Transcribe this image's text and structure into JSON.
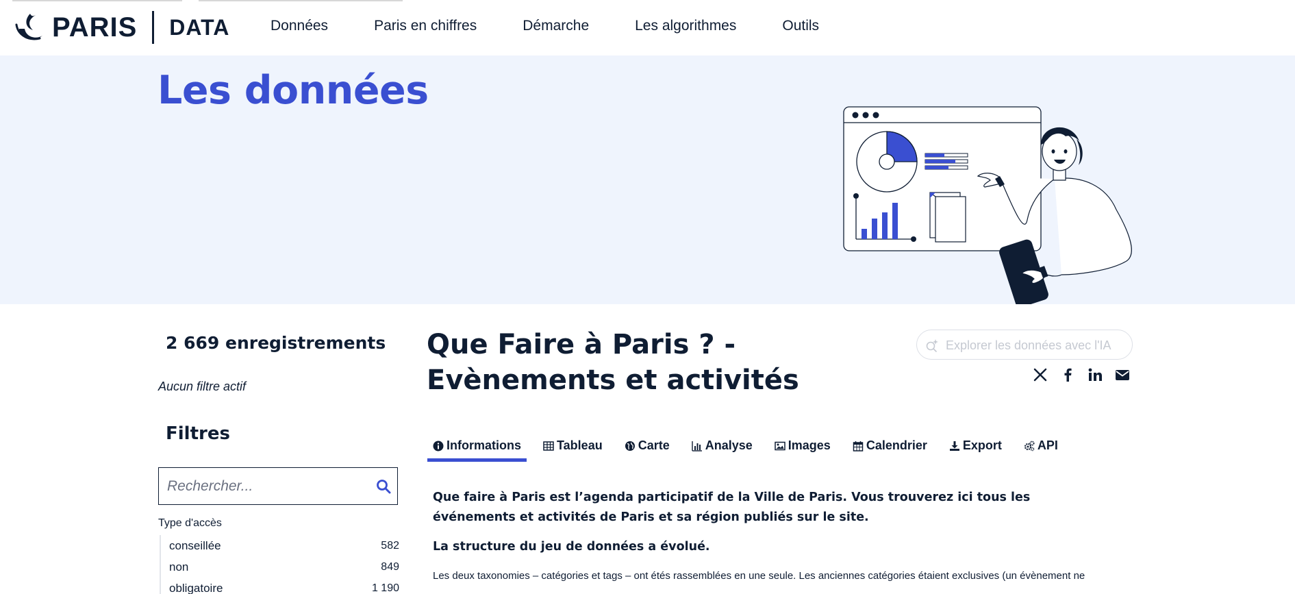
{
  "brand": {
    "city": "PARIS",
    "section": "DATA"
  },
  "nav": [
    {
      "label": "Données"
    },
    {
      "label": "Paris en chiffres"
    },
    {
      "label": "Démarche"
    },
    {
      "label": "Les algorithmes"
    },
    {
      "label": "Outils"
    }
  ],
  "hero": {
    "title": "Les données"
  },
  "sidebar": {
    "records": "2 669 enregistrements",
    "no_filter": "Aucun filtre actif",
    "filters_title": "Filtres",
    "search_placeholder": "Rechercher...",
    "facet": {
      "title": "Type d'accès",
      "items": [
        {
          "label": "conseillée",
          "count": "582"
        },
        {
          "label": "non",
          "count": "849"
        },
        {
          "label": "obligatoire",
          "count": "1 190"
        }
      ]
    }
  },
  "dataset": {
    "title": "Que Faire à Paris ? - Evènements et activités",
    "ai_placeholder": "Explorer les données avec l'IA",
    "share": [
      "x-icon",
      "facebook-icon",
      "linkedin-icon",
      "email-icon"
    ],
    "tabs": [
      {
        "label": "Informations",
        "icon": "info-icon",
        "active": true
      },
      {
        "label": "Tableau",
        "icon": "table-icon"
      },
      {
        "label": "Carte",
        "icon": "globe-icon"
      },
      {
        "label": "Analyse",
        "icon": "bar-chart-icon"
      },
      {
        "label": "Images",
        "icon": "image-icon"
      },
      {
        "label": "Calendrier",
        "icon": "calendar-icon"
      },
      {
        "label": "Export",
        "icon": "download-icon"
      },
      {
        "label": "API",
        "icon": "gears-icon"
      }
    ],
    "description": {
      "lead": "Que faire à Paris est l’agenda participatif de la Ville de Paris. Vous trouverez ici tous les événements et activités de Paris et sa région publiés sur le site.",
      "sub": "La structure du jeu de données a évolué.",
      "body": "Les deux taxonomies – catégories et tags – ont étés rassemblées en une seule. Les anciennes catégories étaient exclusives (un évènement ne"
    }
  },
  "colors": {
    "accent": "#3a4fd1",
    "hero_bg": "#eff4fd",
    "ink": "#0f1d33"
  }
}
